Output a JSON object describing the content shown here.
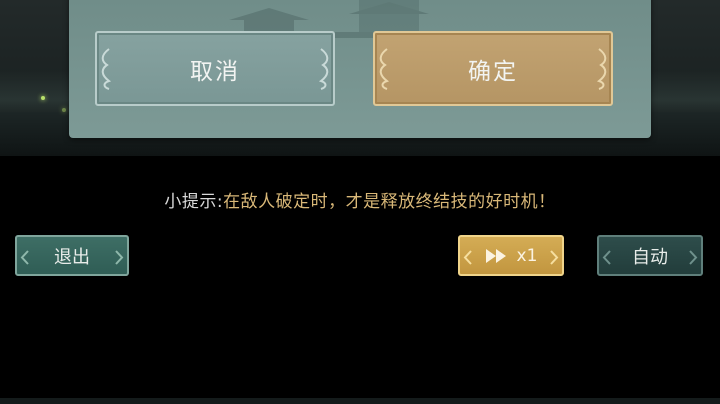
{
  "dialog": {
    "cancel_label": "取消",
    "confirm_label": "确定"
  },
  "hint": {
    "label": "小提示:",
    "message": "在敌人破定时，才是释放终结技的好时机！"
  },
  "controls": {
    "exit_label": "退出",
    "speed_label": "x1",
    "auto_label": "自动"
  },
  "colors": {
    "confirm_gold": "#c2a372",
    "cancel_teal": "#86a2a0",
    "hint_gold": "#d9b878",
    "speed_gold": "#d4ac55",
    "exit_green": "#3e6e65",
    "auto_dark": "#2e4d4b"
  },
  "icons": {
    "speed": "fast-forward-icon"
  }
}
